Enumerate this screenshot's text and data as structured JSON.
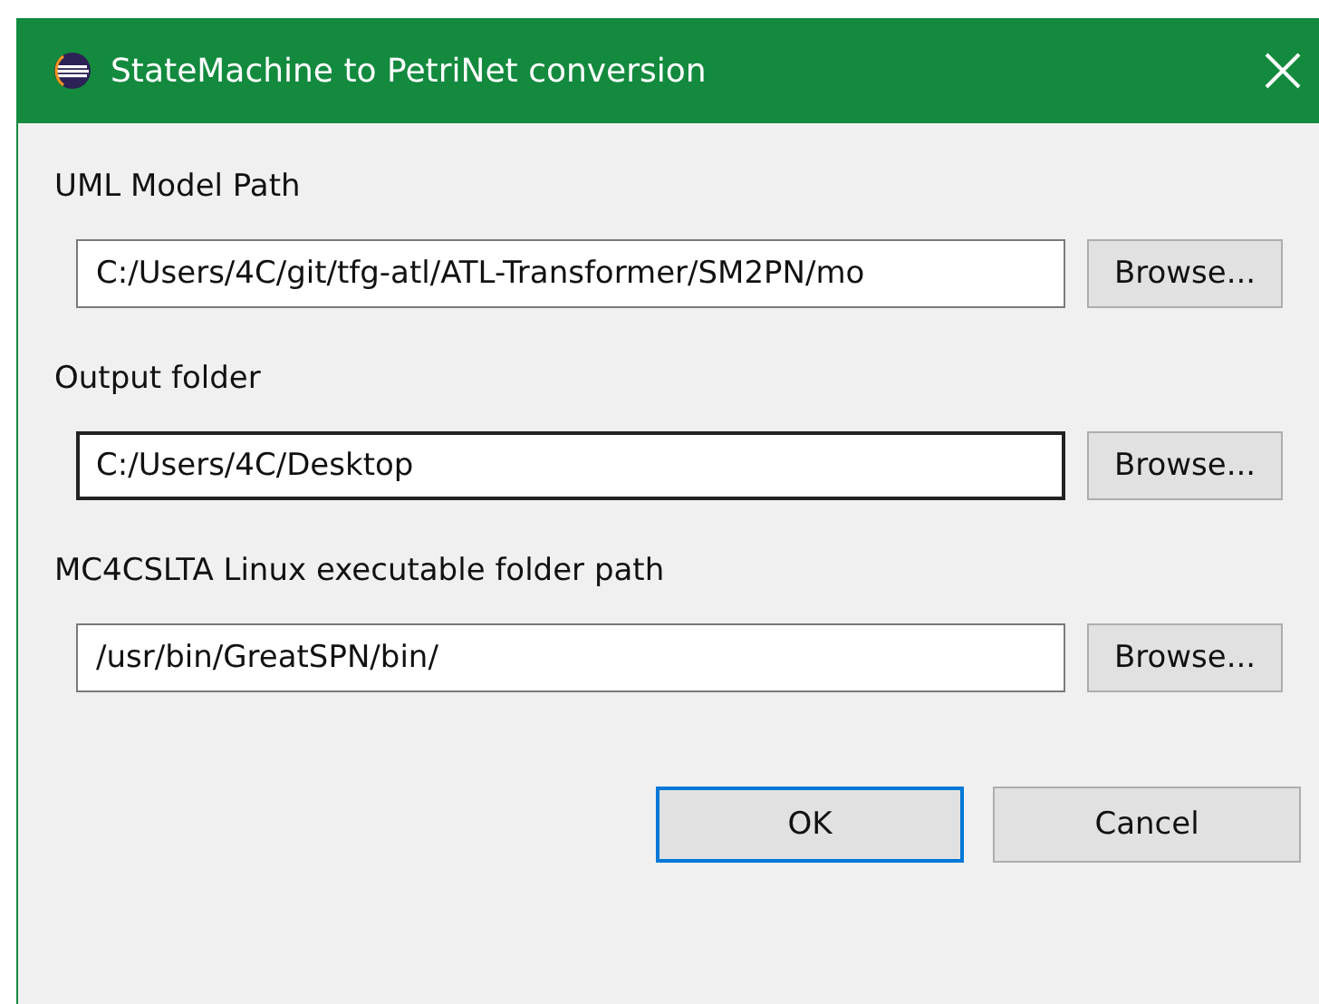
{
  "window": {
    "title": "StateMachine to PetriNet conversion"
  },
  "fields": [
    {
      "label": "UML Model Path",
      "value": "C:/Users/4C/git/tfg-atl/ATL-Transformer/SM2PN/mo",
      "focused": false,
      "button": "Browse..."
    },
    {
      "label": "Output folder",
      "value": "C:/Users/4C/Desktop",
      "focused": true,
      "button": "Browse..."
    },
    {
      "label": "MC4CSLTA Linux executable folder path",
      "value": "/usr/bin/GreatSPN/bin/",
      "focused": false,
      "button": "Browse..."
    }
  ],
  "buttons": [
    {
      "label": "OK",
      "default": true
    },
    {
      "label": "Cancel",
      "default": false
    }
  ]
}
